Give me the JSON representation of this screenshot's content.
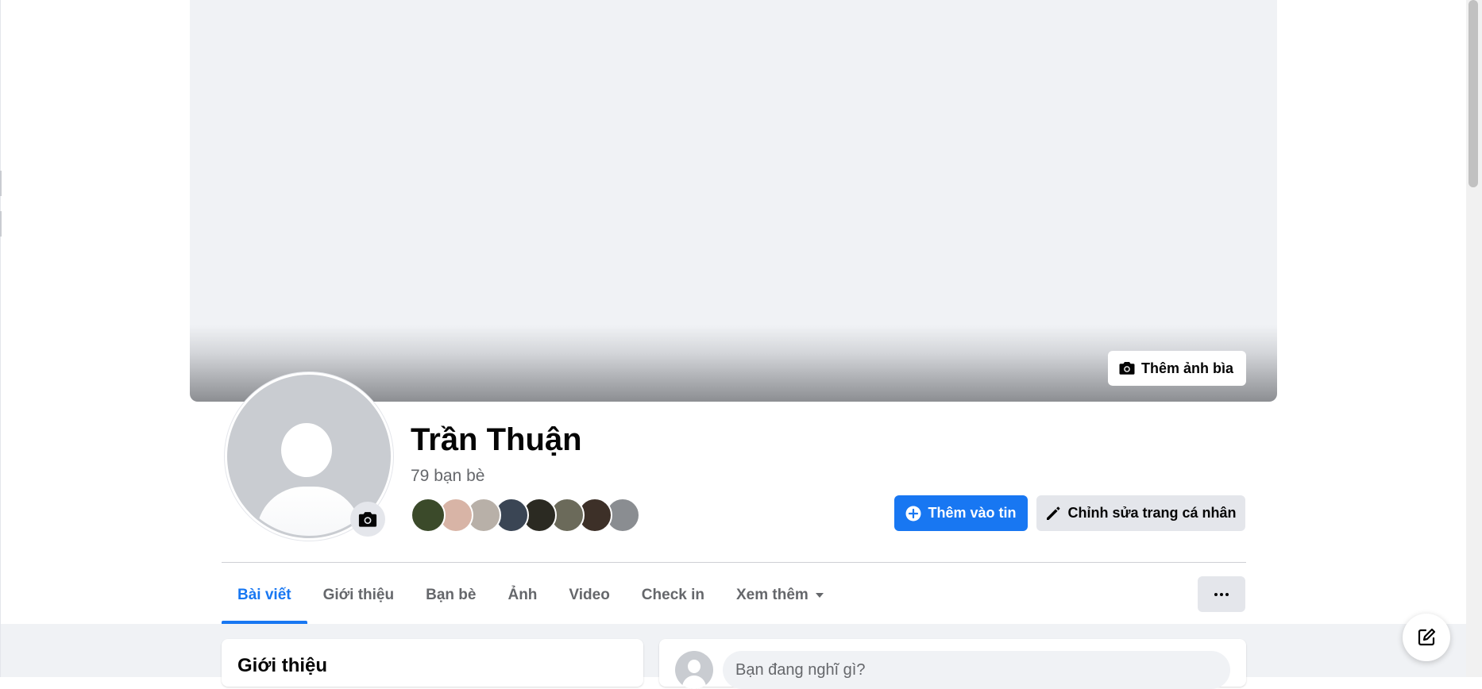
{
  "profile": {
    "name": "Trần Thuận",
    "friends_count": "79 bạn bè"
  },
  "cover": {
    "add_cover_label": "Thêm ảnh bìa"
  },
  "actions": {
    "add_story_label": "Thêm vào tin",
    "edit_profile_label": "Chỉnh sửa trang cá nhân"
  },
  "friend_avatars": [
    {
      "color": "#3b4a2a"
    },
    {
      "color": "#d8b4a6"
    },
    {
      "color": "#b8b0a8"
    },
    {
      "color": "#3a4554"
    },
    {
      "color": "#2b2a22"
    },
    {
      "color": "#6b6a5a"
    },
    {
      "color": "#3d3028"
    },
    {
      "color": "#8a8d91"
    }
  ],
  "tabs": [
    {
      "label": "Bài viết",
      "active": true
    },
    {
      "label": "Giới thiệu",
      "active": false
    },
    {
      "label": "Bạn bè",
      "active": false
    },
    {
      "label": "Ảnh",
      "active": false
    },
    {
      "label": "Video",
      "active": false
    },
    {
      "label": "Check in",
      "active": false
    },
    {
      "label": "Xem thêm",
      "active": false
    }
  ],
  "intro": {
    "title": "Giới thiệu"
  },
  "composer": {
    "placeholder": "Bạn đang nghĩ gì?"
  },
  "colors": {
    "accent": "#1877f2",
    "secondary_button": "#e4e6eb",
    "background": "#f0f2f5"
  },
  "icons": {
    "cover_camera": "camera-icon",
    "avatar_camera": "camera-icon",
    "add_story": "plus-circle-icon",
    "edit": "pencil-icon",
    "dropdown": "caret-down-icon",
    "more": "ellipsis-icon",
    "new_message": "compose-icon"
  }
}
